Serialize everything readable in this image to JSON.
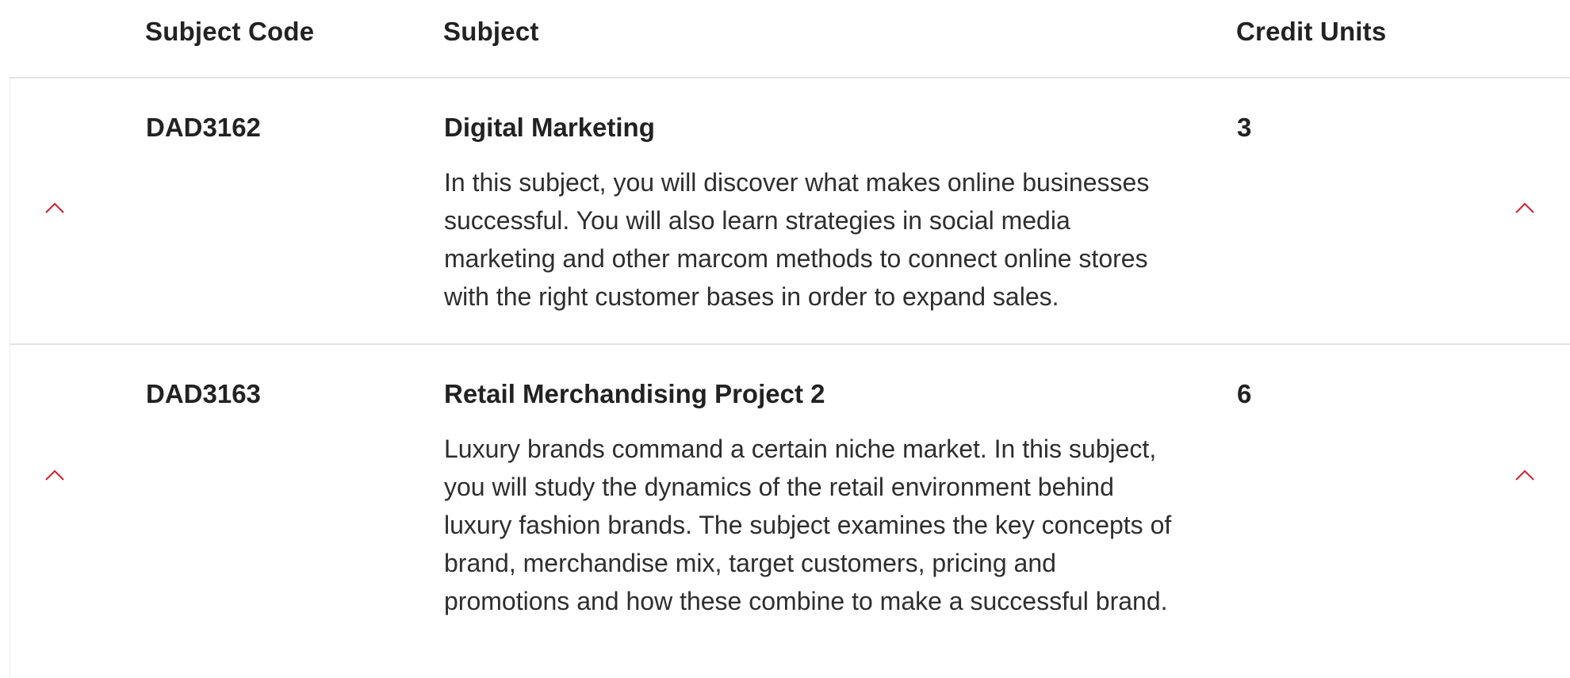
{
  "table": {
    "headers": {
      "code": "Subject Code",
      "subject": "Subject",
      "credits": "Credit Units"
    },
    "rows": [
      {
        "code": "DAD3162",
        "title": "Digital Marketing",
        "credits": "3",
        "description": "In this subject, you will discover what makes online businesses successful. You will also learn strategies in social media marketing and other marcom methods to connect online stores with the right customer bases in order to expand sales.",
        "expand_icon": "chevron-up-icon"
      },
      {
        "code": "DAD3163",
        "title": "Retail Merchandising Project 2",
        "credits": "6",
        "description": "Luxury brands command a certain niche market. In this subject, you will study the dynamics of the retail environment behind luxury fashion brands. The subject examines the key concepts of brand, merchandise mix, target customers, pricing and promotions and how these combine to make a successful brand.",
        "expand_icon": "chevron-up-icon"
      }
    ]
  },
  "colors": {
    "accent": "#d0202e",
    "text": "#222222",
    "divider": "#e3e3e3"
  }
}
